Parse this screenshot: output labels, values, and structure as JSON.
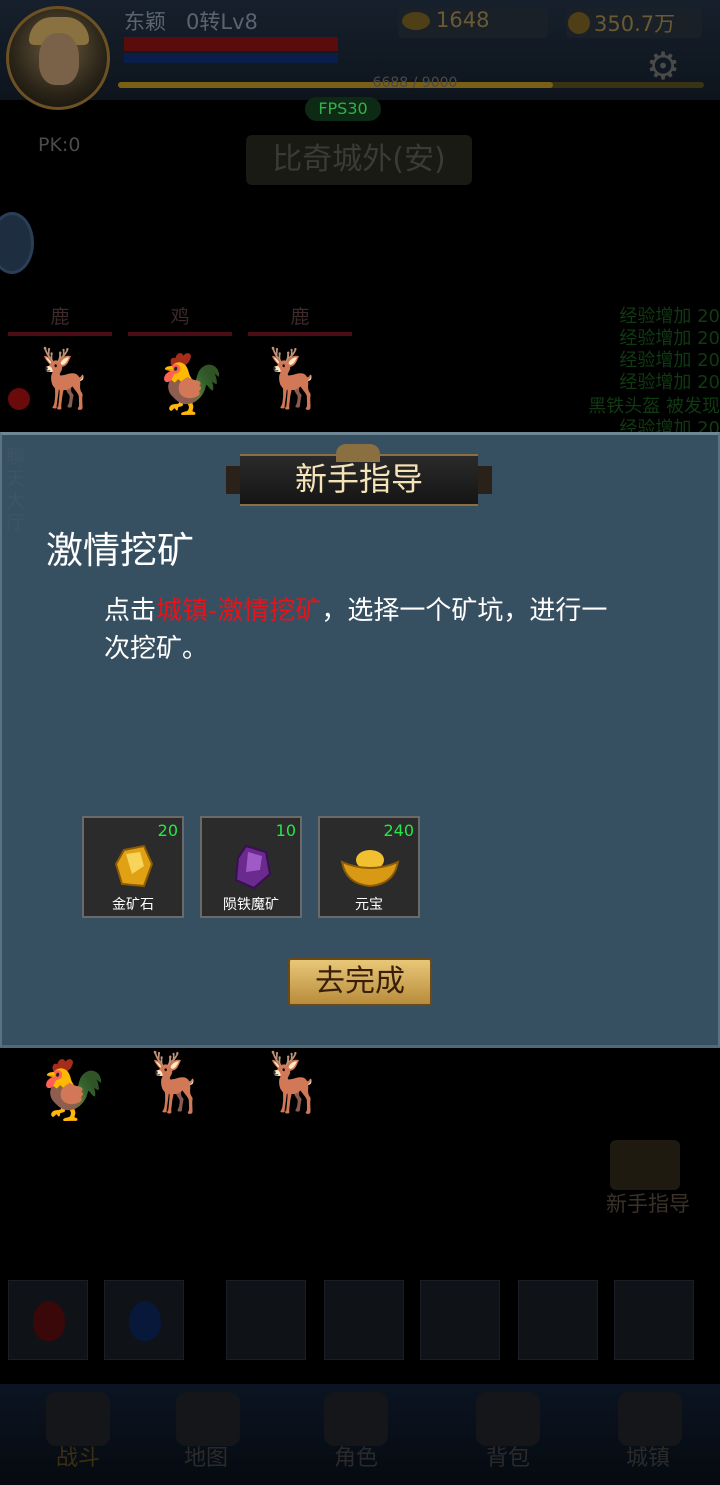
{
  "player": {
    "name": "东颖",
    "level": "0转Lv8",
    "pk": "PK:0",
    "exp_text": "6688 / 9000",
    "exp_progress": 0.743
  },
  "currency": {
    "ingot": "1648",
    "coins": "350.7万"
  },
  "fps": "FPS30",
  "map_name": "比奇城外(安)",
  "enemies": [
    "鹿",
    "鸡",
    "鹿"
  ],
  "system_log": [
    "经验增加 20",
    "经验增加 20",
    "经验增加 20",
    "经验增加 20",
    "黑铁头盔 被发现",
    "经验增加 20"
  ],
  "side_chat": "聊天大厅",
  "guide_shortcut": "新手指导",
  "bottom_nav": [
    "战斗",
    "地图",
    "角色",
    "背包",
    "城镇"
  ],
  "dialog": {
    "title": "新手指导",
    "quest_title": "激情挖矿",
    "desc_prefix": "点击",
    "desc_highlight": "城镇-激情挖矿",
    "desc_suffix": "，选择一个矿坑，进行一次挖矿。",
    "rewards": [
      {
        "name": "金矿石",
        "count": "20",
        "icon": "gold-ore-icon"
      },
      {
        "name": "陨铁魔矿",
        "count": "10",
        "icon": "purple-ore-icon"
      },
      {
        "name": "元宝",
        "count": "240",
        "icon": "ingot-icon"
      }
    ],
    "button": "去完成"
  },
  "colors": {
    "dialog_bg": "#375061",
    "highlight": "#e8121a",
    "count_green": "#22e84a",
    "button_gold": "#d4ae5c"
  }
}
